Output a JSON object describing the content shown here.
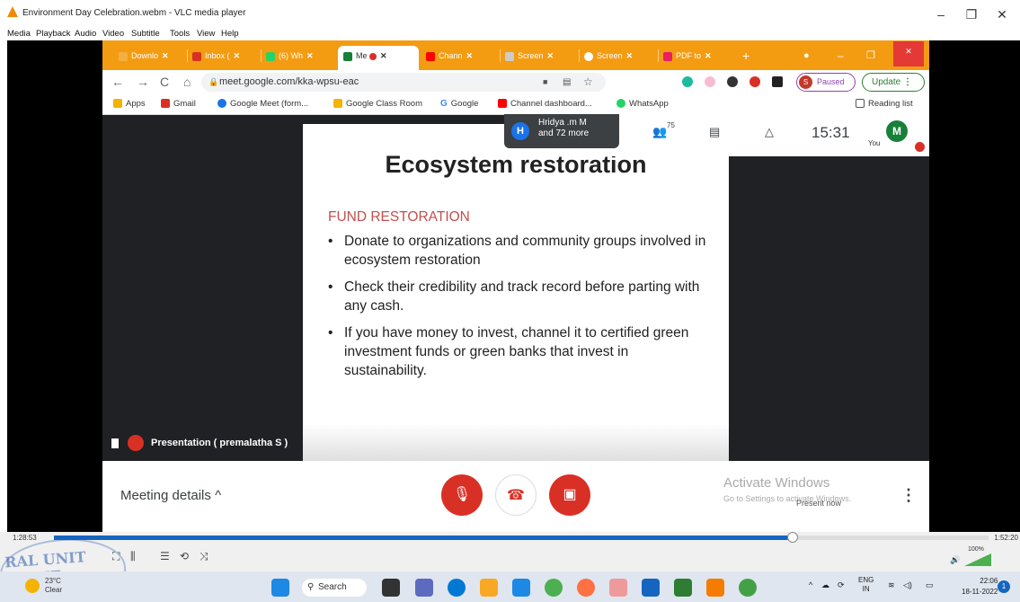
{
  "vlc": {
    "title": "Environment Day Celebration.webm - VLC media player",
    "menu": [
      "Media",
      "Playback",
      "Audio",
      "Video",
      "Subtitle",
      "Tools",
      "View",
      "Help"
    ],
    "time_left": "1:28:53",
    "time_right": "1:52:20",
    "progress": 0.79,
    "volume": "100%",
    "watermark": "RAL UNIT WOME"
  },
  "browser": {
    "tabs": [
      {
        "label": "Downlo",
        "color": "#fff"
      },
      {
        "label": "Inbox (",
        "color": "#d93025"
      },
      {
        "label": "(6) Wh",
        "color": "#25d366"
      },
      {
        "label": "Me",
        "color": "#188038"
      },
      {
        "label": "Chann",
        "color": "#ff0000"
      },
      {
        "label": "Screen",
        "color": "#888"
      },
      {
        "label": "Screen",
        "color": "#555"
      },
      {
        "label": "PDF to",
        "color": "#e91e63"
      }
    ],
    "url": "meet.google.com/kka-wpsu-eac",
    "paused_label": "Paused",
    "paused_avatar": "S",
    "update_label": "Update",
    "bookmarks": [
      {
        "label": "Apps",
        "color": "#f4b400"
      },
      {
        "label": "Gmail",
        "color": "#d93025"
      },
      {
        "label": "Google Meet (form...",
        "color": "#1a73e8"
      },
      {
        "label": "Google Class Room",
        "color": "#f4b400"
      },
      {
        "label": "Google",
        "color": "#4285f4"
      },
      {
        "label": "Channel dashboard...",
        "color": "#ff0000"
      },
      {
        "label": "WhatsApp",
        "color": "#25d366"
      }
    ],
    "reading_list": "Reading list"
  },
  "meet": {
    "people_avatar": "H",
    "people_line1": "Hridya .m M",
    "people_line2": "and 72 more",
    "participants_count": "75",
    "time": "15:31",
    "you_label": "You",
    "you_avatar": "M",
    "presenter": "Presentation ( premalatha S )",
    "meeting_details": "Meeting details",
    "activate_title": "Activate Windows",
    "activate_sub": "Go to Settings to activate Windows.",
    "present_now": "Present now"
  },
  "slide": {
    "title": "Ecosystem restoration",
    "subtitle": "FUND RESTORATION",
    "bullets": [
      "Donate to organizations and community groups involved in ecosystem restoration",
      "Check their credibility and track record before parting with any cash.",
      "If you have money to invest, channel it to certified green investment funds or green banks that invest in sustainability."
    ]
  },
  "taskbar": {
    "temp": "23°C",
    "condition": "Clear",
    "search": "Search",
    "lang1": "ENG",
    "lang2": "IN",
    "time": "22:06",
    "date": "18-11-2022",
    "notifications": "1"
  }
}
